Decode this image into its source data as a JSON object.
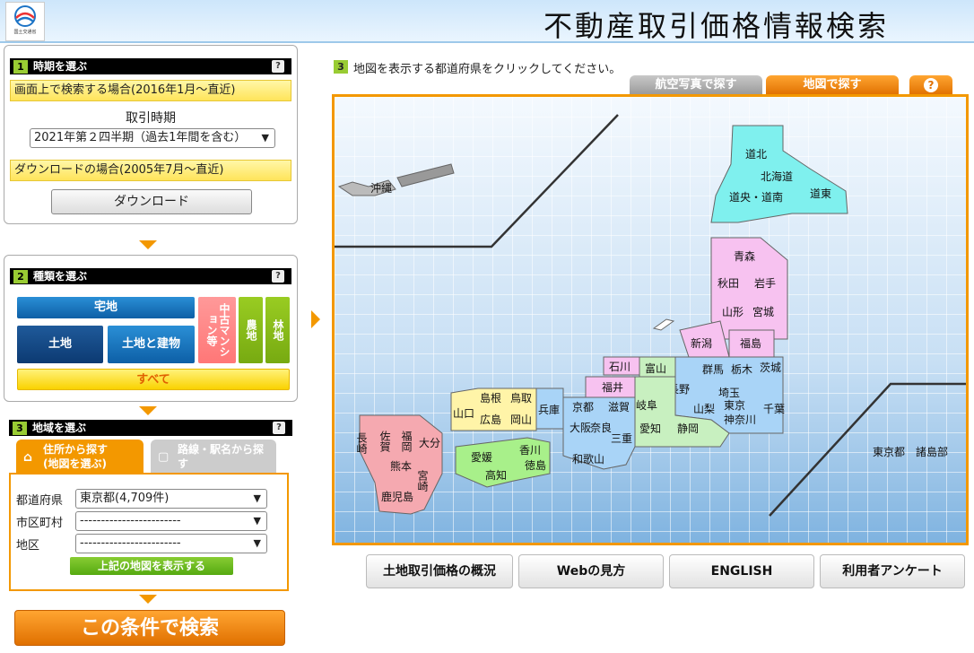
{
  "header": {
    "title": "不動産取引価格情報検索",
    "logo_text": "国土交通省"
  },
  "step1": {
    "num": "1",
    "title": "時期を選ぶ",
    "help": "?",
    "screen_label": "画面上で検索する場合(2016年1月～直近)",
    "period_label": "取引時期",
    "period_value": "2021年第２四半期（過去1年間を含む）",
    "download_label": "ダウンロードの場合(2005年7月～直近)",
    "download_button": "ダウンロード"
  },
  "step2": {
    "num": "2",
    "title": "種類を選ぶ",
    "help": "?",
    "takuchi": "宅地",
    "tochi": "土地",
    "tochi_tatemono": "土地と建物",
    "mansion": "中古マンション等",
    "nochi": "農地",
    "rinchi": "林地",
    "subete": "すべて"
  },
  "step3": {
    "num": "3",
    "title": "地域を選ぶ",
    "help": "?",
    "tab_address": "住所から探す\n(地図を選ぶ)",
    "tab_station": "路線・駅名から探す",
    "pref_label": "都道府県",
    "pref_value": "東京都(4,709件)",
    "city_label": "市区町村",
    "city_value": "------------------------",
    "district_label": "地区",
    "district_value": "------------------------",
    "show_map_button": "上記の地図を表示する",
    "search_button": "この条件で検索"
  },
  "map": {
    "step_num": "3",
    "instruction": "地図を表示する都道府県をクリックしてください。",
    "tab_photo": "航空写真で探す",
    "tab_map": "地図で探す",
    "tab_help": "?"
  },
  "prefectures": {
    "doh": "道北",
    "hokkaido": "北海道",
    "dochuo": "道央・道南",
    "doto": "道東",
    "aomori": "青森",
    "akita": "秋田",
    "iwate": "岩手",
    "yamagata": "山形",
    "miyagi": "宮城",
    "niigata": "新潟",
    "fukushima": "福島",
    "ishikawa": "石川",
    "toyama": "富山",
    "gunma": "群馬",
    "tochigi": "栃木",
    "ibaraki": "茨城",
    "nagano": "長野",
    "fukui": "福井",
    "gifu": "岐阜",
    "saitama": "埼玉",
    "tokyo": "東京",
    "chiba": "千葉",
    "yamanashi": "山梨",
    "kanagawa": "神奈川",
    "shizuoka": "静岡",
    "aichi": "愛知",
    "shimane": "島根",
    "tottori": "鳥取",
    "yamaguchi": "山口",
    "hiroshima": "広島",
    "okayama": "岡山",
    "hyogo": "兵庫",
    "kyoto": "京都",
    "shiga": "滋賀",
    "osaka": "大阪",
    "nara": "奈良",
    "mie": "三重",
    "wakayama": "和歌山",
    "kagawa": "香川",
    "ehime": "愛媛",
    "tokushima": "徳島",
    "kochi": "高知",
    "saga": "佐賀",
    "fukuoka": "福岡",
    "nagasaki": "長崎",
    "oita": "大分",
    "kumamoto": "熊本",
    "miyazaki": "宮崎",
    "kagoshima": "鹿児島",
    "okinawa": "沖縄",
    "tokyo_islands": "東京都　諸島部"
  },
  "bottom_links": {
    "overview": "土地取引価格の概況",
    "web_guide": "Webの見方",
    "english": "ENGLISH",
    "survey": "利用者アンケート"
  },
  "colors": {
    "accent_orange": "#f39800",
    "step_green": "#99cc33",
    "hokkaido": "#7ff0ee",
    "tohoku": "#f7c2f0",
    "kanto": "#a9d4f7",
    "chubu": "#c8f0c0",
    "kansai": "#a9d4f7",
    "chugoku": "#fff4a8",
    "shikoku": "#a8f08a",
    "kyushu": "#f5a9b0"
  }
}
